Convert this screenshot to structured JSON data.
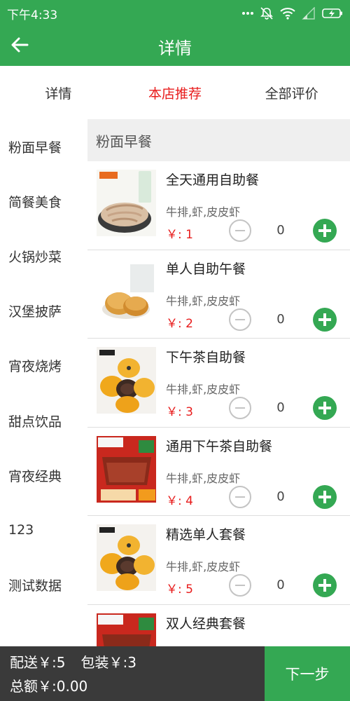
{
  "status_bar": {
    "time": "下午4:33"
  },
  "header": {
    "title": "详情"
  },
  "tabs": [
    {
      "label": "详情",
      "active": false
    },
    {
      "label": "本店推荐",
      "active": true
    },
    {
      "label": "全部评价",
      "active": false
    }
  ],
  "categories": [
    "粉面早餐",
    "简餐美食",
    "火锅炒菜",
    "汉堡披萨",
    "宵夜烧烤",
    "甜点饮品",
    "宵夜经典",
    "123",
    "测试数据"
  ],
  "section": {
    "title": "粉面早餐"
  },
  "products": [
    {
      "name": "全天通用自助餐",
      "desc": "牛排,虾,皮皮虾",
      "price": "￥: 1",
      "qty": "0",
      "image": "sliced-meat-dish"
    },
    {
      "name": "单人自助午餐",
      "desc": "牛排,虾,皮皮虾",
      "price": "￥: 2",
      "qty": "0",
      "image": "pastry-buns"
    },
    {
      "name": "下午茶自助餐",
      "desc": "牛排,虾,皮皮虾",
      "price": "￥: 3",
      "qty": "0",
      "image": "egg-yolk-pastry"
    },
    {
      "name": "通用下午茶自助餐",
      "desc": "牛排,虾,皮皮虾",
      "price": "￥: 4",
      "qty": "0",
      "image": "jerky-promo"
    },
    {
      "name": "精选单人套餐",
      "desc": "牛排,虾,皮皮虾",
      "price": "￥: 5",
      "qty": "0",
      "image": "egg-yolk-pastry"
    },
    {
      "name": "双人经典套餐",
      "desc": "",
      "price": "",
      "qty": "",
      "image": "jerky-promo"
    }
  ],
  "bottom": {
    "delivery": "配送￥:5",
    "packing": "包装￥:3",
    "total": "总额￥:0.00",
    "next_label": "下一步"
  },
  "colors": {
    "brand_green": "#34a853",
    "price_red": "#e81c1c",
    "bottom_dark": "#3a3a3a"
  }
}
